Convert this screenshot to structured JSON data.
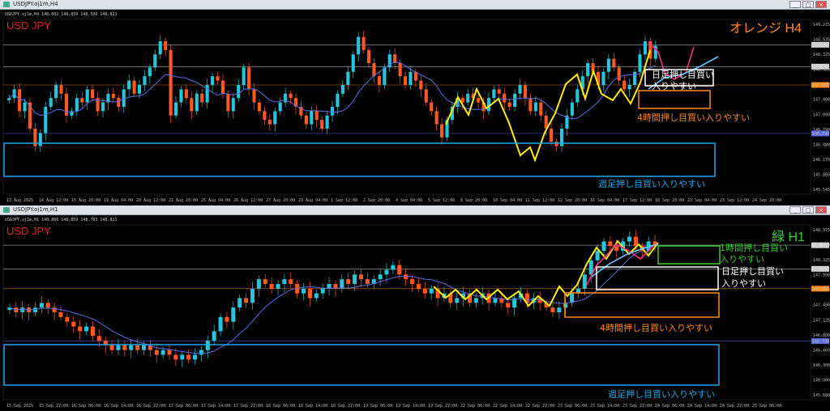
{
  "colors": {
    "background": "#000000",
    "bull": "#26c6da",
    "bear": "#ff5722",
    "ma": "#5b6ee1",
    "zigzag": "#ffee00",
    "accent_orange": "#ff8c1a",
    "weekly_blue": "#1ea7e8",
    "daily_white": "#ffffff",
    "h1_green": "#33cc33",
    "pink": "#ff2d8a",
    "lightblue": "#6ec6ff",
    "red_label": "#e02020"
  },
  "windows": [
    {
      "title": "USDJPY.oj1m,H4",
      "buttons": [
        "_",
        "□",
        "×"
      ],
      "ohlc_text": "USDJPY.oj1m,H4  148.602 148.859 148.596 148.821",
      "symbol": "USD JPY",
      "timeframe_label": "オレンジ H4",
      "timeframe_color": "#ff8c1a",
      "y_range": [
        145.4,
        149.4
      ],
      "price_ticks": [
        "149.215",
        "148.935",
        "148.325",
        "148.020",
        "147.710",
        "147.400",
        "147.090",
        "146.790",
        "146.480",
        "146.170",
        "145.860",
        "145.545"
      ],
      "price_tags": [
        {
          "value": "148.821",
          "price": 148.82,
          "color": "#d8d8d8"
        },
        {
          "value": "148.325",
          "price": 148.32,
          "color": "#d8d8d8"
        },
        {
          "value": "147.896",
          "price": 147.9,
          "color": "#ff8c1a"
        },
        {
          "value": "146.790",
          "price": 146.79,
          "color": "#5b6ee1"
        }
      ],
      "date_ticks": [
        "13 Aug 2025",
        "14 Aug 12:00",
        "15 Aug 20:00",
        "19 Aug 04:00",
        "20 Aug 12:00",
        "21 Aug 20:00",
        "25 Aug 04:00",
        "26 Aug 12:00",
        "27 Aug 20:00",
        "29 Aug 04:00",
        "1 Sep 12:00",
        "2 Sep 20:00",
        "4 Sep 04:00",
        "5 Sep 12:00",
        "8 Sep 20:00",
        "10 Sep 04:00",
        "11 Sep 12:00",
        "12 Sep 20:00",
        "16 Sep 04:00",
        "17 Sep 12:00",
        "18 Sep 20:00",
        "22 Sep 04:00",
        "23 Sep 12:00",
        "24 Sep 20:00"
      ],
      "annotations": {
        "weekly": "週足押し目買い入りやすい",
        "h4": "4時間押し目買い入りやすい",
        "daily_line1": "日足押し目買い",
        "daily_line2": "入りやすい"
      }
    },
    {
      "title": "USDJPY.oj1m,H1",
      "buttons": [
        "_",
        "□",
        "×"
      ],
      "ohlc_text": "USDJPY.oj1m,H1  148.866 148.859 148.763 148.821",
      "symbol": "USD JPY",
      "timeframe_label": "緑 H1",
      "timeframe_color": "#33cc33",
      "y_range": [
        145.55,
        149.25
      ],
      "price_ticks": [
        "148.975",
        "148.650",
        "148.325",
        "147.990",
        "147.660",
        "147.490",
        "147.125",
        "146.800",
        "146.460",
        "146.300",
        "146.000",
        "145.680"
      ],
      "price_tags": [
        {
          "value": "148.821",
          "price": 148.82,
          "color": "#d8d8d8"
        },
        {
          "value": "148.325",
          "price": 148.32,
          "color": "#d8d8d8"
        },
        {
          "value": "147.896",
          "price": 147.9,
          "color": "#ff8c1a"
        },
        {
          "value": "146.790",
          "price": 146.79,
          "color": "#5b6ee1"
        }
      ],
      "date_ticks": [
        "15 Sep 2025",
        "15 Sep 22:00",
        "16 Sep 06:00",
        "16 Sep 14:00",
        "16 Sep 22:00",
        "17 Sep 06:00",
        "17 Sep 14:00",
        "17 Sep 22:00",
        "18 Sep 06:00",
        "18 Sep 14:00",
        "18 Sep 22:00",
        "19 Sep 06:00",
        "19 Sep 14:00",
        "19 Sep 22:00",
        "22 Sep 06:00",
        "22 Sep 14:00",
        "22 Sep 22:00",
        "23 Sep 06:00",
        "23 Sep 14:00",
        "23 Sep 22:00",
        "24 Sep 06:00",
        "24 Sep 14:00",
        "24 Sep 22:00",
        "25 Sep 06:00"
      ],
      "annotations": {
        "weekly": "週足押し目買い入りやすい",
        "h4": "4時間押し目買い入りやすい",
        "daily_line1": "日足押し目買い",
        "daily_line2": "入りやすい",
        "h1_line1": "1時間押し目買い",
        "h1_line2": "入りやすい"
      }
    }
  ],
  "chart_data": [
    {
      "type": "candlestick",
      "title": "USDJPY.oj1m,H4",
      "xlabel": "",
      "ylabel": "",
      "ylim": [
        145.4,
        149.4
      ],
      "close_series": [
        147.6,
        147.8,
        147.3,
        147.5,
        146.9,
        146.5,
        146.8,
        147.4,
        147.6,
        147.9,
        147.7,
        147.2,
        147.3,
        147.6,
        147.5,
        147.8,
        147.6,
        147.3,
        147.5,
        147.7,
        147.6,
        147.4,
        147.8,
        148.0,
        147.7,
        147.9,
        148.1,
        148.3,
        148.6,
        148.9,
        148.7,
        147.2,
        147.5,
        147.8,
        147.6,
        147.3,
        147.7,
        147.5,
        147.9,
        148.1,
        148.0,
        147.7,
        147.3,
        147.6,
        147.9,
        148.3,
        147.8,
        147.5,
        147.3,
        147.1,
        147.0,
        147.3,
        147.5,
        147.7,
        147.6,
        147.4,
        147.2,
        147.0,
        147.3,
        147.1,
        146.9,
        147.2,
        147.4,
        147.7,
        147.9,
        148.2,
        148.6,
        149.0,
        148.7,
        148.4,
        148.1,
        147.9,
        148.3,
        148.6,
        148.4,
        148.1,
        147.9,
        148.2,
        148.0,
        147.8,
        147.5,
        147.3,
        147.0,
        146.7,
        147.1,
        147.4,
        147.6,
        147.5,
        147.7,
        147.6,
        147.5,
        147.3,
        147.6,
        147.8,
        147.7,
        147.5,
        147.4,
        147.7,
        147.9,
        147.6,
        147.3,
        147.5,
        147.2,
        146.9,
        146.6,
        146.5,
        146.9,
        147.2,
        147.5,
        147.8,
        148.1,
        148.4,
        148.2,
        147.9,
        148.2,
        148.5,
        148.3,
        148.0,
        147.8,
        147.9,
        148.2,
        148.6,
        148.9,
        148.5,
        148.8
      ]
    },
    {
      "type": "candlestick",
      "title": "USDJPY.oj1m,H1",
      "xlabel": "",
      "ylabel": "",
      "ylim": [
        145.55,
        149.25
      ],
      "close_series": [
        147.5,
        147.4,
        147.5,
        147.4,
        147.5,
        147.6,
        147.5,
        147.4,
        147.3,
        147.2,
        147.1,
        147.0,
        147.1,
        146.9,
        146.8,
        146.7,
        146.6,
        146.7,
        146.6,
        146.7,
        146.6,
        146.7,
        146.6,
        146.5,
        146.6,
        146.5,
        146.4,
        146.5,
        146.4,
        146.5,
        146.6,
        146.8,
        147.0,
        147.3,
        147.2,
        147.5,
        147.7,
        147.6,
        147.9,
        148.1,
        148.0,
        147.9,
        148.0,
        148.1,
        148.0,
        147.8,
        147.9,
        147.7,
        147.8,
        147.9,
        148.0,
        147.9,
        148.1,
        148.0,
        148.2,
        148.1,
        148.0,
        148.1,
        148.2,
        148.3,
        148.4,
        148.2,
        148.1,
        148.0,
        147.9,
        147.8,
        147.9,
        147.7,
        147.8,
        147.6,
        147.7,
        147.8,
        147.6,
        147.7,
        147.8,
        147.6,
        147.7,
        147.6,
        147.5,
        147.7,
        147.8,
        147.6,
        147.7,
        147.6,
        147.5,
        147.4,
        147.5,
        147.6,
        147.8,
        147.9,
        148.2,
        148.5,
        148.7,
        148.9,
        148.8,
        148.7,
        148.9,
        149.0,
        148.8,
        148.7,
        148.9,
        148.8
      ]
    }
  ]
}
